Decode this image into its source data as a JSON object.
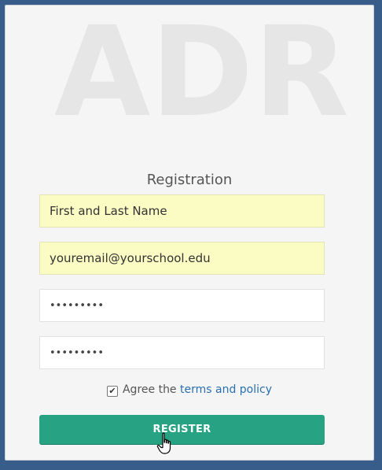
{
  "watermark": "ADR",
  "form": {
    "title": "Registration",
    "name_value": "First and Last Name",
    "email_value": "youremail@yourschool.edu",
    "password_value": "•••••••••",
    "confirm_password_value": "•••••••••",
    "agree_text": "Agree the",
    "terms_link": "terms and policy",
    "agree_checked": true,
    "register_label": "REGISTER"
  },
  "colors": {
    "background": "#385d8a",
    "panel": "#f5f5f5",
    "autofill": "#fbfbc4",
    "register_button": "#27a384",
    "link": "#2a6fb1"
  }
}
